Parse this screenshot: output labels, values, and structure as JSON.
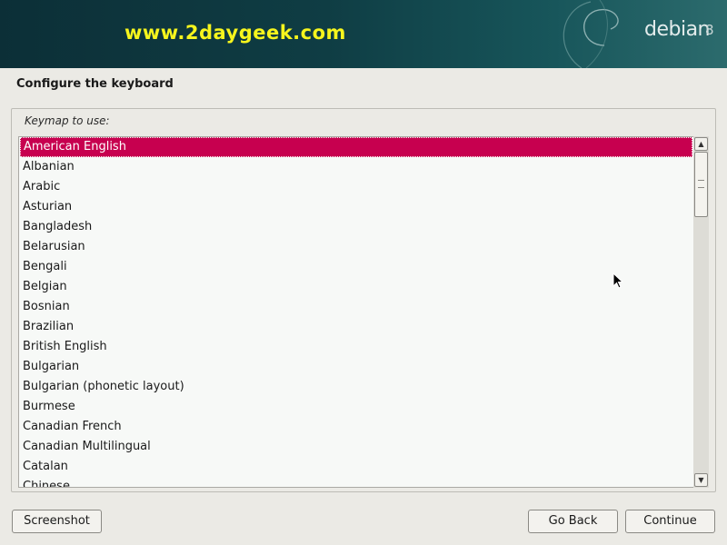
{
  "banner": {
    "watermark": "www.2daygeek.com",
    "logo_text": "debian",
    "logo_version": "8"
  },
  "page": {
    "title": "Configure the keyboard"
  },
  "keymap": {
    "label": "Keymap to use:",
    "selected_index": 0,
    "items": [
      "American English",
      "Albanian",
      "Arabic",
      "Asturian",
      "Bangladesh",
      "Belarusian",
      "Bengali",
      "Belgian",
      "Bosnian",
      "Brazilian",
      "British English",
      "Bulgarian",
      "Bulgarian (phonetic layout)",
      "Burmese",
      "Canadian French",
      "Canadian Multilingual",
      "Catalan",
      "Chinese"
    ]
  },
  "buttons": {
    "screenshot": "Screenshot",
    "go_back": "Go Back",
    "continue": "Continue"
  },
  "colors": {
    "selection": "#c7004f",
    "banner_dark": "#0c2f37",
    "watermark": "#f6f51d"
  },
  "icons": {
    "scroll_up": "triangle-up",
    "scroll_down": "triangle-down",
    "cursor": "arrow-pointer",
    "logo": "debian-swirl"
  }
}
